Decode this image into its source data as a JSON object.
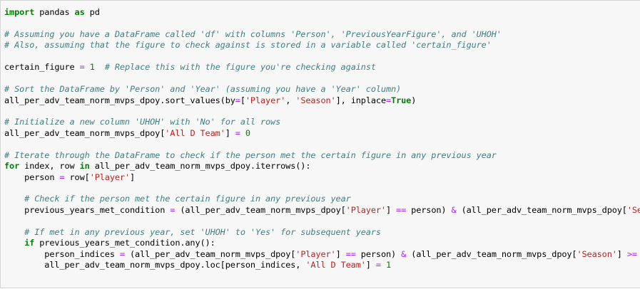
{
  "code_cell": {
    "lines": [
      [
        {
          "t": "kw",
          "v": "import"
        },
        {
          "t": "tx",
          "v": " pandas "
        },
        {
          "t": "kw",
          "v": "as"
        },
        {
          "t": "tx",
          "v": " pd"
        }
      ],
      [],
      [
        {
          "t": "cm",
          "v": "# Assuming you have a DataFrame called 'df' with columns 'Person', 'PreviousYearFigure', and 'UHOH'"
        }
      ],
      [
        {
          "t": "cm",
          "v": "# Also, assuming that the figure to check against is stored in a variable called 'certain_figure'"
        }
      ],
      [],
      [
        {
          "t": "tx",
          "v": "certain_figure "
        },
        {
          "t": "op",
          "v": "="
        },
        {
          "t": "tx",
          "v": " "
        },
        {
          "t": "nm",
          "v": "1"
        },
        {
          "t": "tx",
          "v": "  "
        },
        {
          "t": "cm",
          "v": "# Replace this with the figure you're checking against"
        }
      ],
      [],
      [
        {
          "t": "cm",
          "v": "# Sort the DataFrame by 'Person' and 'Year' (assuming you have a 'Year' column)"
        }
      ],
      [
        {
          "t": "tx",
          "v": "all_per_adv_team_norm_mvps_dpoy.sort_values(by"
        },
        {
          "t": "op",
          "v": "="
        },
        {
          "t": "tx",
          "v": "["
        },
        {
          "t": "st",
          "v": "'Player'"
        },
        {
          "t": "tx",
          "v": ", "
        },
        {
          "t": "st",
          "v": "'Season'"
        },
        {
          "t": "tx",
          "v": "], inplace"
        },
        {
          "t": "op",
          "v": "="
        },
        {
          "t": "kw",
          "v": "True"
        },
        {
          "t": "tx",
          "v": ")"
        }
      ],
      [],
      [
        {
          "t": "cm",
          "v": "# Initialize a new column 'UHOH' with 'No' for all rows"
        }
      ],
      [
        {
          "t": "tx",
          "v": "all_per_adv_team_norm_mvps_dpoy["
        },
        {
          "t": "st",
          "v": "'All D Team'"
        },
        {
          "t": "tx",
          "v": "] "
        },
        {
          "t": "op",
          "v": "="
        },
        {
          "t": "tx",
          "v": " "
        },
        {
          "t": "nm",
          "v": "0"
        }
      ],
      [],
      [
        {
          "t": "cm",
          "v": "# Iterate through the DataFrame to check if the person met the certain figure in any previous year"
        }
      ],
      [
        {
          "t": "kw",
          "v": "for"
        },
        {
          "t": "tx",
          "v": " index, row "
        },
        {
          "t": "kw",
          "v": "in"
        },
        {
          "t": "tx",
          "v": " all_per_adv_team_norm_mvps_dpoy.iterrows():"
        }
      ],
      [
        {
          "t": "tx",
          "v": "    person "
        },
        {
          "t": "op",
          "v": "="
        },
        {
          "t": "tx",
          "v": " row["
        },
        {
          "t": "st",
          "v": "'Player'"
        },
        {
          "t": "tx",
          "v": "]"
        }
      ],
      [],
      [
        {
          "t": "tx",
          "v": "    "
        },
        {
          "t": "cm",
          "v": "# Check if the person met the certain figure in any previous year"
        }
      ],
      [
        {
          "t": "tx",
          "v": "    previous_years_met_condition "
        },
        {
          "t": "op",
          "v": "="
        },
        {
          "t": "tx",
          "v": " (all_per_adv_team_norm_mvps_dpoy["
        },
        {
          "t": "st",
          "v": "'Player'"
        },
        {
          "t": "tx",
          "v": "] "
        },
        {
          "t": "op",
          "v": "=="
        },
        {
          "t": "tx",
          "v": " person) "
        },
        {
          "t": "op",
          "v": "&"
        },
        {
          "t": "tx",
          "v": " (all_per_adv_team_norm_mvps_dpoy["
        },
        {
          "t": "st",
          "v": "'Seas"
        }
      ],
      [],
      [
        {
          "t": "tx",
          "v": "    "
        },
        {
          "t": "cm",
          "v": "# If met in any previous year, set 'UHOH' to 'Yes' for subsequent years"
        }
      ],
      [
        {
          "t": "tx",
          "v": "    "
        },
        {
          "t": "kw",
          "v": "if"
        },
        {
          "t": "tx",
          "v": " previous_years_met_condition.any():"
        }
      ],
      [
        {
          "t": "tx",
          "v": "        person_indices "
        },
        {
          "t": "op",
          "v": "="
        },
        {
          "t": "tx",
          "v": " (all_per_adv_team_norm_mvps_dpoy["
        },
        {
          "t": "st",
          "v": "'Player'"
        },
        {
          "t": "tx",
          "v": "] "
        },
        {
          "t": "op",
          "v": "=="
        },
        {
          "t": "tx",
          "v": " person) "
        },
        {
          "t": "op",
          "v": "&"
        },
        {
          "t": "tx",
          "v": " (all_per_adv_team_norm_mvps_dpoy["
        },
        {
          "t": "st",
          "v": "'Season'"
        },
        {
          "t": "tx",
          "v": "] "
        },
        {
          "t": "op",
          "v": ">="
        },
        {
          "t": "tx",
          "v": " ro"
        }
      ],
      [
        {
          "t": "tx",
          "v": "        all_per_adv_team_norm_mvps_dpoy.loc[person_indices, "
        },
        {
          "t": "st",
          "v": "'All D Team'"
        },
        {
          "t": "tx",
          "v": "] "
        },
        {
          "t": "op",
          "v": "="
        },
        {
          "t": "tx",
          "v": " "
        },
        {
          "t": "nm",
          "v": "1"
        }
      ]
    ]
  }
}
